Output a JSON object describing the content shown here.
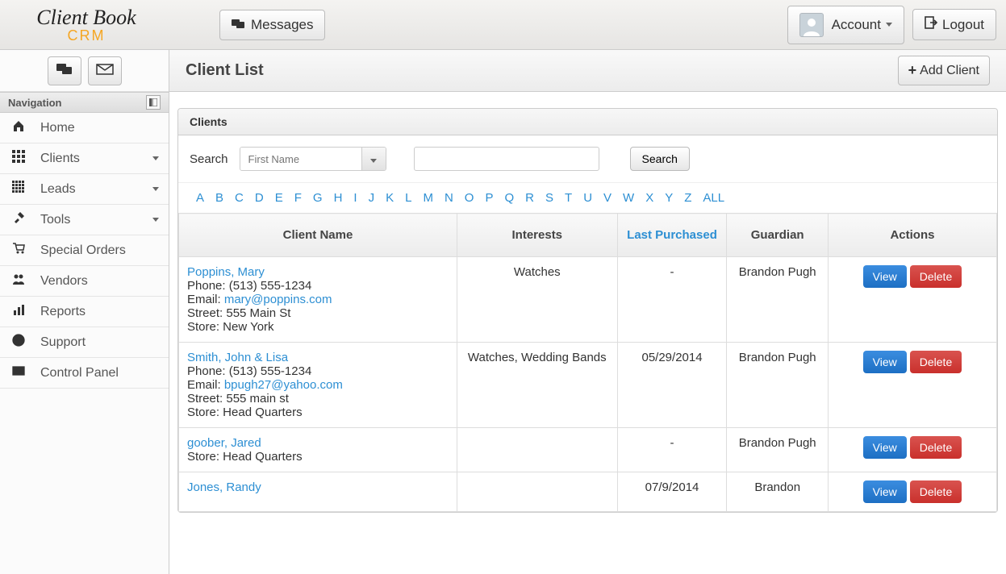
{
  "header": {
    "logo_top": "Client Book",
    "logo_bottom": "CRM",
    "messages_label": "Messages",
    "account_label": "Account",
    "logout_label": "Logout"
  },
  "sidebar": {
    "nav_header": "Navigation",
    "items": [
      {
        "label": "Home",
        "icon": "home",
        "has_sub": false
      },
      {
        "label": "Clients",
        "icon": "grid3",
        "has_sub": true
      },
      {
        "label": "Leads",
        "icon": "grid4",
        "has_sub": true
      },
      {
        "label": "Tools",
        "icon": "tools",
        "has_sub": true
      },
      {
        "label": "Special Orders",
        "icon": "cart",
        "has_sub": false
      },
      {
        "label": "Vendors",
        "icon": "people",
        "has_sub": false
      },
      {
        "label": "Reports",
        "icon": "chart",
        "has_sub": false
      },
      {
        "label": "Support",
        "icon": "globe",
        "has_sub": false
      },
      {
        "label": "Control Panel",
        "icon": "panel",
        "has_sub": false
      }
    ]
  },
  "page": {
    "title": "Client List",
    "add_client_label": "Add Client"
  },
  "panel": {
    "title": "Clients",
    "search_label": "Search",
    "search_field_placeholder": "First Name",
    "search_button_label": "Search"
  },
  "alphabet": [
    "A",
    "B",
    "C",
    "D",
    "E",
    "F",
    "G",
    "H",
    "I",
    "J",
    "K",
    "L",
    "M",
    "N",
    "O",
    "P",
    "Q",
    "R",
    "S",
    "T",
    "U",
    "V",
    "W",
    "X",
    "Y",
    "Z",
    "ALL"
  ],
  "table": {
    "headers": {
      "client_name": "Client Name",
      "interests": "Interests",
      "last_purchased": "Last Purchased",
      "guardian": "Guardian",
      "actions": "Actions"
    },
    "view_label": "View",
    "delete_label": "Delete",
    "rows": [
      {
        "name": "Poppins, Mary",
        "phone": "Phone: (513) 555-1234",
        "email_label": "Email: ",
        "email": "mary@poppins.com",
        "street": "Street: 555 Main St",
        "store": "Store: New York",
        "interests": "Watches",
        "last_purchased": "-",
        "guardian": "Brandon Pugh"
      },
      {
        "name": "Smith, John & Lisa",
        "phone": "Phone: (513) 555-1234",
        "email_label": "Email: ",
        "email": "bpugh27@yahoo.com",
        "street": "Street: 555 main st",
        "store": "Store: Head Quarters",
        "interests": "Watches, Wedding Bands",
        "last_purchased": "05/29/2014",
        "guardian": "Brandon Pugh"
      },
      {
        "name": "goober, Jared",
        "phone": "",
        "email_label": "",
        "email": "",
        "street": "",
        "store": "Store: Head Quarters",
        "interests": "",
        "last_purchased": "-",
        "guardian": "Brandon Pugh"
      },
      {
        "name": "Jones, Randy",
        "phone": "",
        "email_label": "",
        "email": "",
        "street": "",
        "store": "",
        "interests": "",
        "last_purchased": "07/9/2014",
        "guardian": "Brandon"
      }
    ]
  }
}
